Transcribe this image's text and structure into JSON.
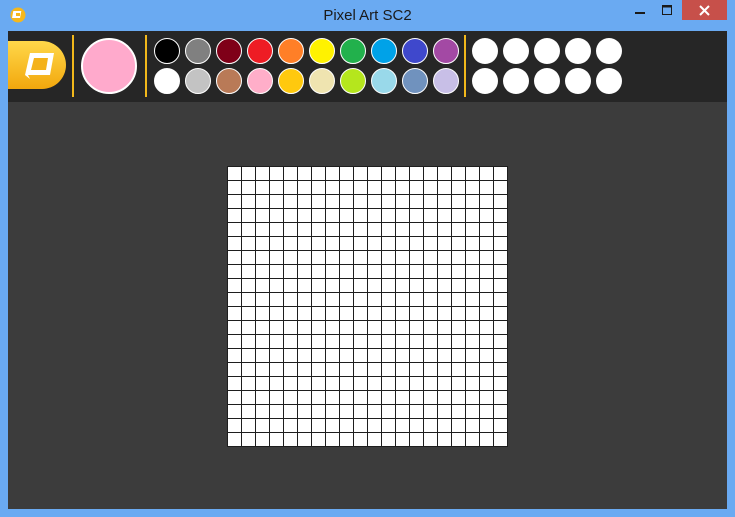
{
  "window": {
    "title": "Pixel Art SC2",
    "app_icon": "app-logo-icon",
    "controls": [
      "minimize-icon",
      "maximize-icon",
      "close-icon"
    ]
  },
  "toolbar": {
    "logo_icon": "pixel-art-logo-icon",
    "accent_color": "#f2b81b",
    "current_color": "#ffaacc",
    "palette": [
      [
        "#000000",
        "#808080",
        "#7f0018",
        "#ee1c24",
        "#ff7f27",
        "#fff200",
        "#22b14c",
        "#00a2e8",
        "#3f48cc",
        "#a349a4"
      ],
      [
        "#ffffff",
        "#c3c3c3",
        "#b97a57",
        "#ffaec9",
        "#ffc90e",
        "#efe4b0",
        "#b5e61d",
        "#99d9ea",
        "#7092be",
        "#c8bfe7"
      ]
    ],
    "custom_colors": [
      [
        "#ffffff",
        "#ffffff",
        "#ffffff",
        "#ffffff",
        "#ffffff"
      ],
      [
        "#ffffff",
        "#ffffff",
        "#ffffff",
        "#ffffff",
        "#ffffff"
      ]
    ]
  },
  "canvas": {
    "columns": 20,
    "rows": 20,
    "pixel_color": "#ffffff",
    "grid_color": "#1e1e1e"
  }
}
